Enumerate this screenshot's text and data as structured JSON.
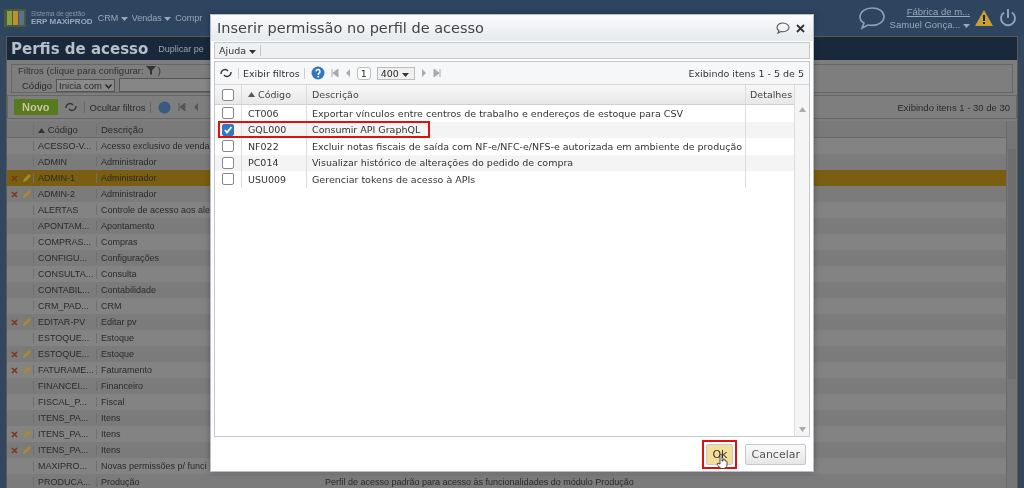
{
  "top_bar": {
    "logo_line1": "Sistema de gestão",
    "logo_line2": "ERP MAXIPROD",
    "menus": [
      {
        "label": "CRM"
      },
      {
        "label": "Vendas"
      },
      {
        "label": "Compr"
      }
    ],
    "company": "Fábrica de m...",
    "user": "Samuel Gonça..."
  },
  "page": {
    "title": "Perfis de acesso",
    "title_action": "Duplicar pe",
    "filters": {
      "legend": "Filtros (clique para configurar:",
      "legend_end": ")",
      "field_label": "Código",
      "operator": "Inicia com"
    },
    "toolbar": {
      "new_button": "Novo",
      "toggle_filters": "Ocultar filtros",
      "status": "Exibindo itens 1 - 30 de 30"
    },
    "table": {
      "columns": [
        "Código",
        "Descrição"
      ],
      "rows": [
        {
          "code": "ACESSO-V...",
          "description": "Acesso exclusivo de venda",
          "editable": false,
          "selected": false
        },
        {
          "code": "ADMIN",
          "description": "Administrador",
          "editable": false,
          "selected": false
        },
        {
          "code": "ADMIN-1",
          "description": "Administrador",
          "editable": true,
          "selected": true
        },
        {
          "code": "ADMIN-2",
          "description": "Administrador",
          "editable": true,
          "selected": false
        },
        {
          "code": "ALERTAS",
          "description": "Controle de acesso aos ale",
          "editable": false,
          "selected": false
        },
        {
          "code": "APONTAM...",
          "description": "Apontamento",
          "editable": false,
          "selected": false
        },
        {
          "code": "COMPRAS...",
          "description": "Compras",
          "editable": false,
          "selected": false
        },
        {
          "code": "CONFIGU...",
          "description": "Configurações",
          "editable": false,
          "selected": false
        },
        {
          "code": "CONSULTA...",
          "description": "Consulta",
          "editable": false,
          "selected": false
        },
        {
          "code": "CONTABIL...",
          "description": "Contabilidade",
          "editable": false,
          "selected": false
        },
        {
          "code": "CRM_PAD...",
          "description": "CRM",
          "editable": false,
          "selected": false
        },
        {
          "code": "EDITAR-PV",
          "description": "Editar pv",
          "editable": true,
          "selected": false
        },
        {
          "code": "ESTOQUE...",
          "description": "Estoque",
          "editable": false,
          "selected": false
        },
        {
          "code": "ESTOQUE...",
          "description": "Estoque",
          "editable": true,
          "selected": false
        },
        {
          "code": "FATURAME...",
          "description": "Faturamento",
          "editable": true,
          "selected": false
        },
        {
          "code": "FINANCEI...",
          "description": "Financeiro",
          "editable": false,
          "selected": false
        },
        {
          "code": "FISCAL_P...",
          "description": "Fiscal",
          "editable": false,
          "selected": false
        },
        {
          "code": "ITENS_PA...",
          "description": "Itens",
          "editable": false,
          "selected": false
        },
        {
          "code": "ITENS_PA...",
          "description": "Itens",
          "editable": true,
          "selected": false
        },
        {
          "code": "ITENS_PA...",
          "description": "Itens",
          "editable": true,
          "selected": false
        },
        {
          "code": "MAXIPRO...",
          "description": "Novas permissões p/ funci",
          "editable": false,
          "selected": false
        },
        {
          "code": "PRODUCA...",
          "description": "Produção",
          "column_3": "Perfil de acesso padrão para acesso às funcionalidades do módulo Produção",
          "editable": false,
          "selected": false
        }
      ]
    }
  },
  "dialog": {
    "title": "Inserir permissão no perfil de acesso",
    "menu": [
      {
        "label": "Ajuda"
      }
    ],
    "toolbar": {
      "toggle_filters": "Exibir filtros",
      "page": "1",
      "page_size": "400",
      "status": "Exibindo itens 1 - 5 de 5"
    },
    "table": {
      "columns": [
        "Código",
        "Descrição",
        "Detalhes"
      ],
      "select_all": false,
      "rows": [
        {
          "code": "CT006",
          "description": "Exportar vínculos entre centros de trabalho e endereços de estoque para CSV",
          "checked": false,
          "marked": false
        },
        {
          "code": "GQL000",
          "description": "Consumir API GraphQL",
          "checked": true,
          "marked": true
        },
        {
          "code": "NF022",
          "description": "Excluir notas fiscais de saída com NF-e/NFC-e/NFS-e autorizada em ambiente de produção",
          "checked": false,
          "marked": false
        },
        {
          "code": "PC014",
          "description": "Visualizar histórico de alterações do pedido de compra",
          "checked": false,
          "marked": false
        },
        {
          "code": "USU009",
          "description": "Gerenciar tokens de acesso à APIs",
          "checked": false,
          "marked": false
        }
      ]
    },
    "buttons": [
      {
        "label": "Ok",
        "kind": "primary",
        "marked": true
      },
      {
        "label": "Cancelar",
        "kind": "secondary",
        "marked": false
      }
    ]
  }
}
